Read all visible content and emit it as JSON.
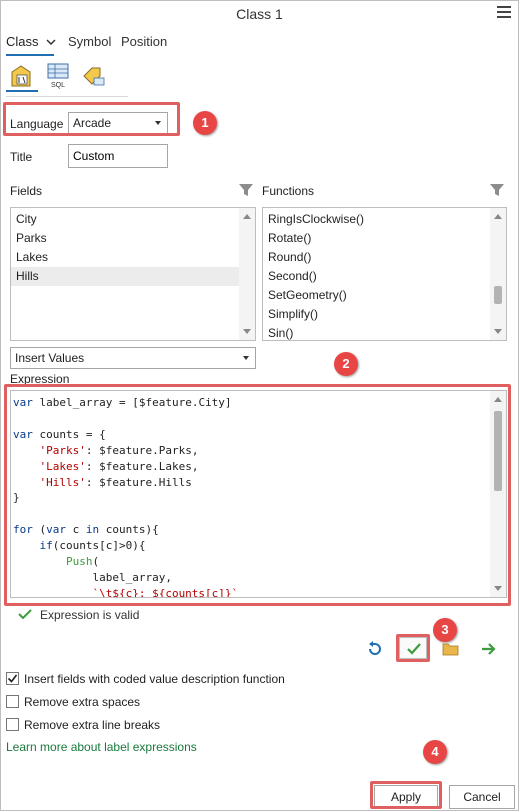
{
  "window": {
    "title": "Class 1"
  },
  "tabs": [
    {
      "label": "Class",
      "active": true
    },
    {
      "label": "Symbol",
      "active": false
    },
    {
      "label": "Position",
      "active": false
    }
  ],
  "iconbar": {
    "sql_label": "SQL"
  },
  "language": {
    "label": "Language",
    "value": "Arcade"
  },
  "title_field": {
    "label": "Title",
    "value": "Custom"
  },
  "fields": {
    "header": "Fields",
    "items": [
      "City",
      "Parks",
      "Lakes",
      "Hills"
    ],
    "selected": "Hills"
  },
  "functions": {
    "header": "Functions",
    "items": [
      "RingIsClockwise()",
      "Rotate()",
      "Round()",
      "Second()",
      "SetGeometry()",
      "Simplify()",
      "Sin()"
    ]
  },
  "insert_values": {
    "value": "Insert Values"
  },
  "expression": {
    "label": "Expression",
    "lines": [
      "var label_array = [$feature.City]",
      "",
      "var counts = {",
      "    'Parks': $feature.Parks,",
      "    'Lakes': $feature.Lakes,",
      "    'Hills': $feature.Hills",
      "}",
      "",
      "for (var c in counts){",
      "    if(counts[c]>0){",
      "        Push(",
      "            label_array,",
      "            `\\t${c}: ${counts[c]}`"
    ]
  },
  "status": {
    "text": "Expression is valid"
  },
  "options": [
    {
      "label": "Insert fields with coded value description function",
      "checked": true
    },
    {
      "label": "Remove extra spaces",
      "checked": false
    },
    {
      "label": "Remove extra line breaks",
      "checked": false
    }
  ],
  "link": {
    "text": "Learn more about label expressions"
  },
  "buttons": {
    "apply": "Apply",
    "cancel": "Cancel"
  },
  "callouts": [
    "1",
    "2",
    "3",
    "4"
  ],
  "colors": {
    "accent": "#1f6fb2",
    "callout": "#e84545",
    "highlight_box": "#e06060",
    "link": "#1a7a3c",
    "valid_check": "#3f9b3f"
  }
}
